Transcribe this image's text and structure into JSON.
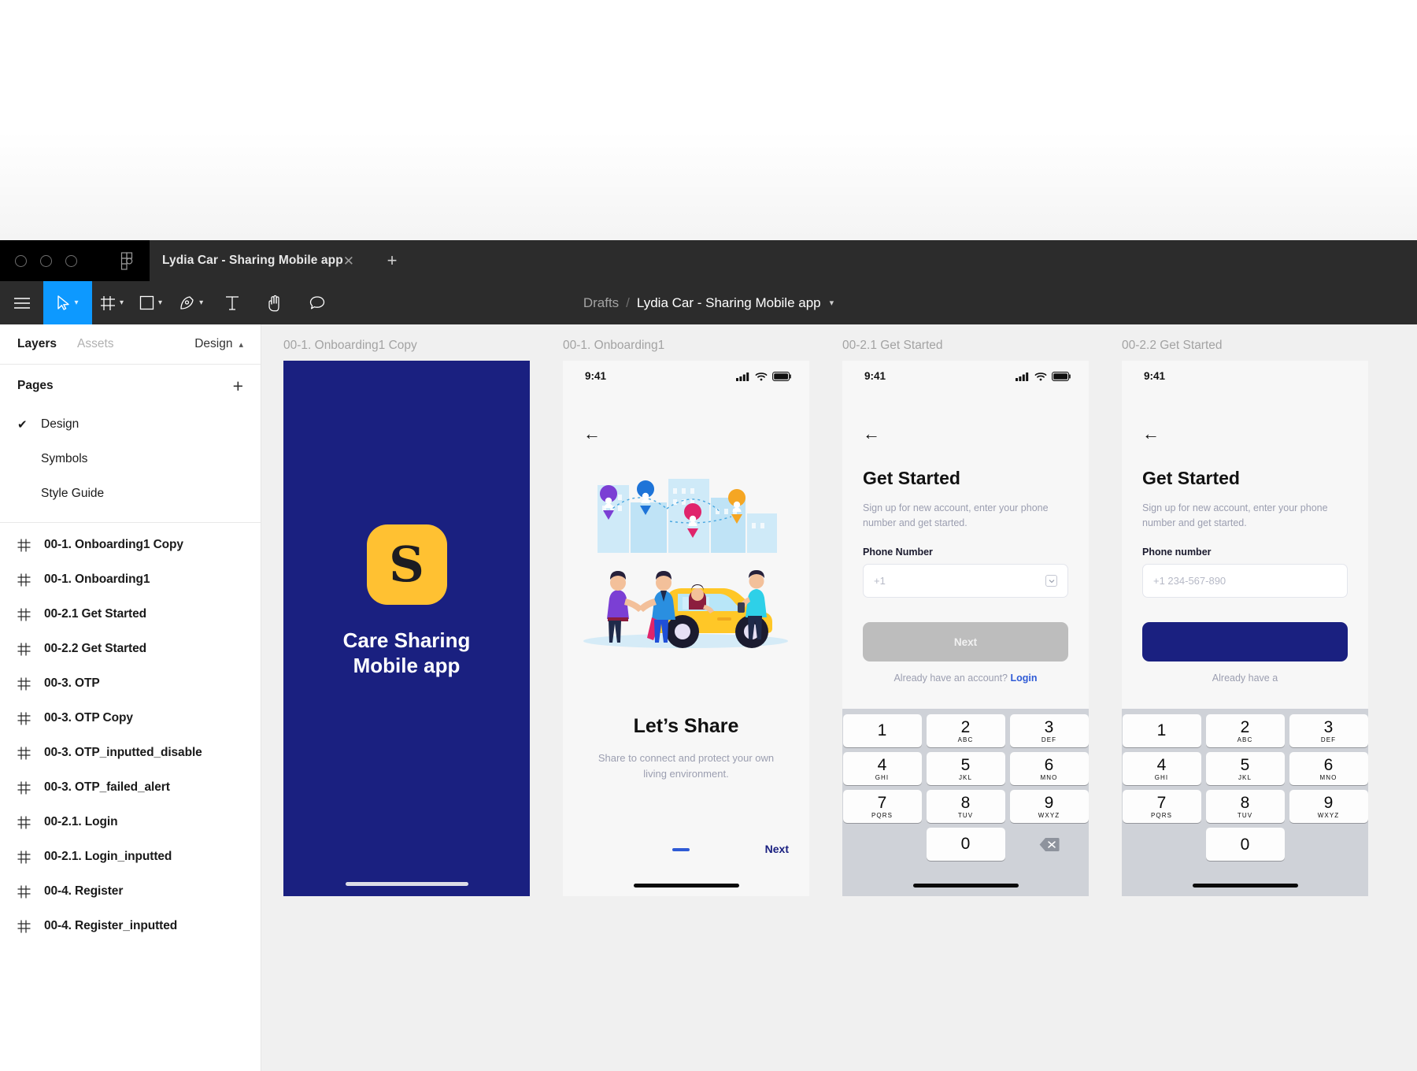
{
  "window": {
    "tab": {
      "title": "Lydia Car - Sharing Mobile app",
      "close_icon": "close-icon",
      "new_tab_icon": "plus-icon"
    },
    "breadcrumb": {
      "root": "Drafts",
      "separator": "/",
      "file": "Lydia Car - Sharing Mobile app",
      "caret": "chevron-down-icon"
    },
    "toolbar": [
      {
        "name": "main-menu",
        "icon": "hamburger-icon",
        "caret": false,
        "active": false
      },
      {
        "name": "move-tool",
        "icon": "cursor-icon",
        "caret": true,
        "active": true
      },
      {
        "name": "frame-tool",
        "icon": "frame-icon",
        "caret": true,
        "active": false
      },
      {
        "name": "shape-tool",
        "icon": "square-icon",
        "caret": true,
        "active": false
      },
      {
        "name": "pen-tool",
        "icon": "pen-icon",
        "caret": true,
        "active": false
      },
      {
        "name": "text-tool",
        "icon": "text-icon",
        "caret": false,
        "active": false
      },
      {
        "name": "hand-tool",
        "icon": "hand-icon",
        "caret": false,
        "active": false
      },
      {
        "name": "comment-tool",
        "icon": "comment-icon",
        "caret": false,
        "active": false
      }
    ]
  },
  "left_panel": {
    "tabs": {
      "layers": "Layers",
      "assets": "Assets",
      "design": "Design",
      "collapse_icon": "chevron-up-icon"
    },
    "pages_header": {
      "title": "Pages",
      "add_icon": "plus-icon"
    },
    "pages": [
      {
        "label": "Design",
        "selected": true,
        "check": "✔"
      },
      {
        "label": "Symbols",
        "selected": false,
        "check": ""
      },
      {
        "label": "Style Guide",
        "selected": false,
        "check": ""
      }
    ],
    "layers": [
      {
        "label": "00-1. Onboarding1 Copy"
      },
      {
        "label": "00-1. Onboarding1"
      },
      {
        "label": "00-2.1 Get Started"
      },
      {
        "label": "00-2.2 Get Started"
      },
      {
        "label": "00-3. OTP"
      },
      {
        "label": "00-3. OTP Copy"
      },
      {
        "label": "00-3. OTP_inputted_disable"
      },
      {
        "label": "00-3. OTP_failed_alert"
      },
      {
        "label": "00-2.1. Login"
      },
      {
        "label": "00-2.1. Login_inputted"
      },
      {
        "label": "00-4. Register"
      },
      {
        "label": "00-4. Register_inputted"
      }
    ]
  },
  "canvas": {
    "boards": [
      {
        "label": "00-1. Onboarding1 Copy"
      },
      {
        "label": "00-1. Onboarding1"
      },
      {
        "label": "00-2.1 Get Started"
      },
      {
        "label": "00-2.2 Get Started"
      }
    ],
    "board1": {
      "logo_letter": "S",
      "title_line1": "Care Sharing",
      "title_line2": "Mobile app"
    },
    "board2": {
      "time": "9:41",
      "back_icon": "arrow-left-icon",
      "heading": "Let’s Share",
      "subtitle": "Share to connect and protect your own living environment.",
      "next_label": "Next"
    },
    "board3": {
      "time": "9:41",
      "back_icon": "arrow-left-icon",
      "heading": "Get Started",
      "subtitle": "Sign up for new account, enter your phone number and get started.",
      "field_label": "Phone Number",
      "field_value": "+1",
      "cta_label": "Next",
      "alt_text": "Already have an account? ",
      "alt_link": "Login",
      "keys": [
        {
          "num": "1",
          "sub": ""
        },
        {
          "num": "2",
          "sub": "ABC"
        },
        {
          "num": "3",
          "sub": "DEF"
        },
        {
          "num": "4",
          "sub": "GHI"
        },
        {
          "num": "5",
          "sub": "JKL"
        },
        {
          "num": "6",
          "sub": "MNO"
        },
        {
          "num": "7",
          "sub": "PQRS"
        },
        {
          "num": "8",
          "sub": "TUV"
        },
        {
          "num": "9",
          "sub": "WXYZ"
        },
        {
          "num": "0",
          "sub": ""
        }
      ],
      "delete_icon": "backspace-icon"
    },
    "board4": {
      "time": "9:41",
      "back_icon": "arrow-left-icon",
      "heading": "Get Started",
      "subtitle": "Sign up for new account, enter your phone number and get started.",
      "field_label": "Phone number",
      "field_value": "+1 234-567-890",
      "alt_text": "Already have a"
    }
  },
  "colors": {
    "brand_navy": "#1a2080",
    "brand_yellow": "#ffc132",
    "accent_blue": "#2f5bd6",
    "figma_blue": "#0d99ff",
    "chrome_dark": "#2c2c2c"
  }
}
